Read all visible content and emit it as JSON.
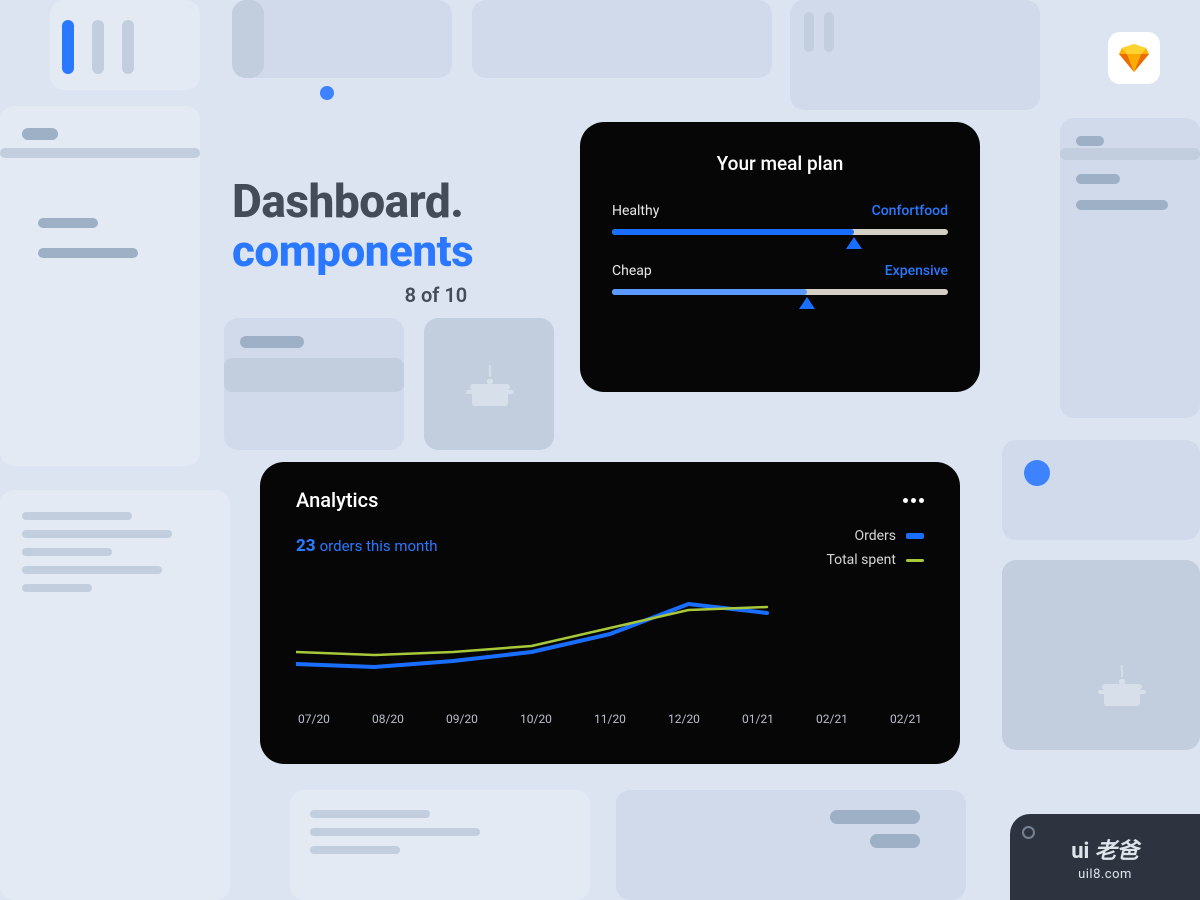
{
  "heading": {
    "line1": "Dashboard.",
    "line2": "components",
    "progress": "8 of 10"
  },
  "sketch_icon": "sketch-diamond",
  "meal_plan": {
    "title": "Your meal plan",
    "sliders": [
      {
        "left": "Healthy",
        "right": "Confortfood",
        "value": 72
      },
      {
        "left": "Cheap",
        "right": "Expensive",
        "value": 58
      }
    ]
  },
  "analytics": {
    "title": "Analytics",
    "orders_count": "23",
    "orders_label": "orders this month",
    "legend": {
      "orders": "Orders",
      "total_spent": "Total spent"
    }
  },
  "chart_data": {
    "type": "line",
    "categories": [
      "07/20",
      "08/20",
      "09/20",
      "10/20",
      "11/20",
      "12/20",
      "01/21",
      "02/21",
      "02/21"
    ],
    "series": [
      {
        "name": "Orders",
        "values": [
          14,
          13,
          15,
          18,
          24,
          34,
          31,
          null,
          null
        ]
      },
      {
        "name": "Total spent",
        "values": [
          18,
          17,
          18,
          20,
          26,
          32,
          33,
          null,
          null
        ]
      }
    ],
    "title": "Analytics",
    "xlabel": "",
    "ylabel": "",
    "ylim": [
      0,
      40
    ]
  },
  "watermark": {
    "brand_prefix": "ui",
    "brand_suffix": "老爸",
    "url": "uil8.com"
  }
}
